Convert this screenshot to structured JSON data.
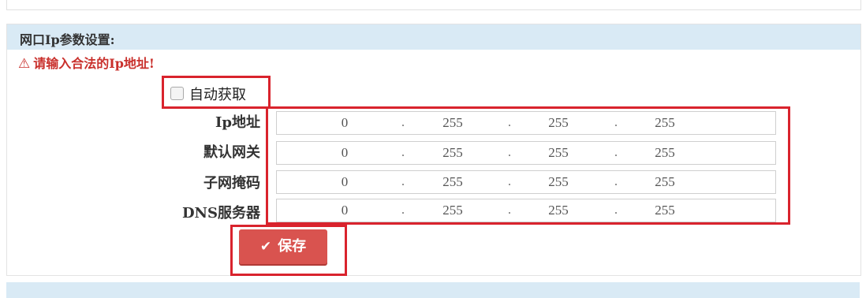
{
  "panel": {
    "title": "网口Ip参数设置:"
  },
  "warning": {
    "icon": "warning-triangle-icon",
    "text": "请输入合法的Ip地址!"
  },
  "auto_obtain": {
    "label": "自动获取",
    "checked": false
  },
  "fields": [
    {
      "label": "Ip地址",
      "octets": [
        "0",
        "255",
        "255",
        "255"
      ]
    },
    {
      "label": "默认网关",
      "octets": [
        "0",
        "255",
        "255",
        "255"
      ]
    },
    {
      "label": "子网掩码",
      "octets": [
        "0",
        "255",
        "255",
        "255"
      ]
    },
    {
      "label": "DNS服务器",
      "octets": [
        "0",
        "255",
        "255",
        "255"
      ]
    }
  ],
  "separator": ".",
  "save": {
    "label": "保存",
    "icon": "check-icon",
    "color": "#d9534f"
  },
  "colors": {
    "header_bg": "#d9eaf5",
    "warning": "#c9302c",
    "highlight_border": "#d9232d"
  }
}
